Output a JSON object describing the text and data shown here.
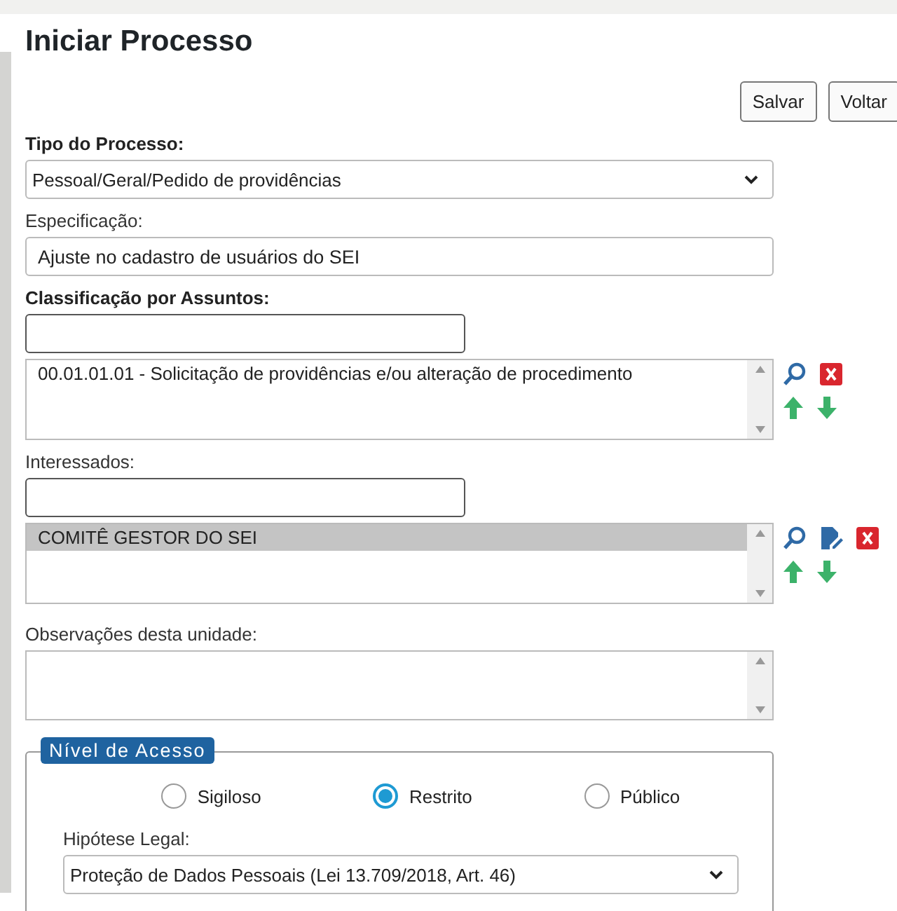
{
  "title": "Iniciar Processo",
  "buttons": [
    "Salvar",
    "Voltar"
  ],
  "tipo": {
    "label": "Tipo do Processo:",
    "value": "Pessoal/Geral/Pedido de providências"
  },
  "especificacao": {
    "label": "Especificação:",
    "value": "Ajuste no cadastro de usuários do SEI"
  },
  "assuntos": {
    "label": "Classificação por Assuntos:",
    "items": [
      {
        "text": "00.01.01.01 - Solicitação de providências e/ou alteração de procedimento",
        "selected": false
      }
    ]
  },
  "interessados": {
    "label": "Interessados:",
    "items": [
      {
        "text": "COMITÊ GESTOR DO SEI",
        "selected": true
      }
    ]
  },
  "observacoes": {
    "label": "Observações desta unidade:"
  },
  "nivel_acesso": {
    "legend": "Nível de Acesso",
    "options": [
      {
        "label": "Sigiloso",
        "selected": false
      },
      {
        "label": "Restrito",
        "selected": true
      },
      {
        "label": "Público",
        "selected": false
      }
    ],
    "hipotese": {
      "label": "Hipótese Legal:",
      "value": "Proteção de Dados Pessoais (Lei 13.709/2018, Art. 46)"
    }
  }
}
